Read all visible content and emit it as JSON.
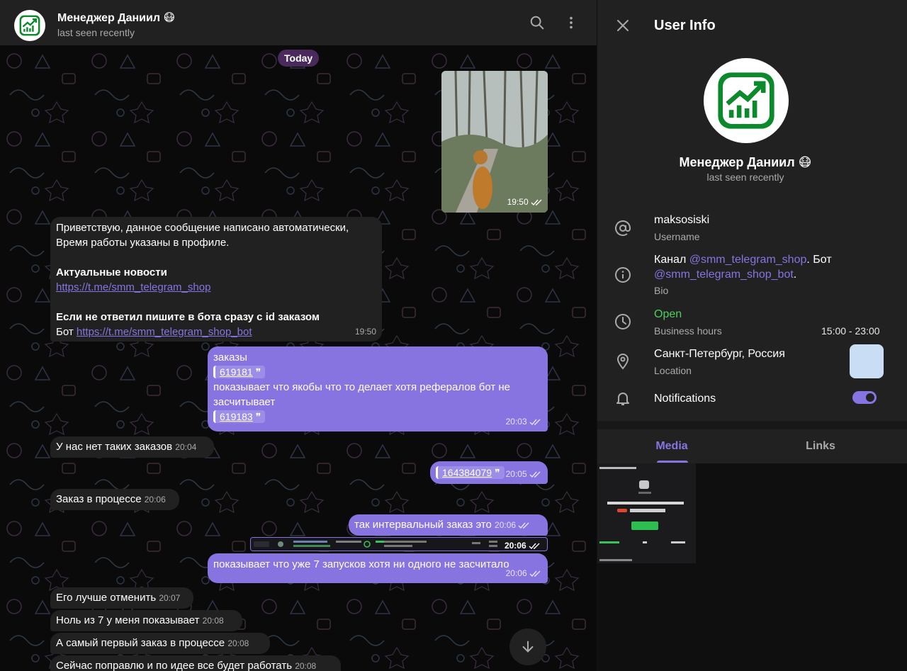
{
  "chat": {
    "header": {
      "name": "Менеджер Даниил 😷",
      "status": "last seen recently"
    },
    "date_label": "Today",
    "messages": {
      "m1_time": "19:50",
      "m2_line1": "Приветствую, данное сообщение написано автоматически,",
      "m2_line2": "Время работы указаны в профиле.",
      "m2_news_title": "Актуальные новости",
      "m2_news_link": "https://t.me/smm_telegram_shop",
      "m2_note": "Если не ответил пишите в бота сразу с id заказом",
      "m2_bot_prefix": "Бот ",
      "m2_bot_link": "https://t.me/smm_telegram_shop_bot",
      "m2_time": "19:50",
      "m3_line1": "заказы",
      "m3_quote1": "619181",
      "m3_line2": "показывает что якобы что то делает хотя рефералов бот не",
      "m3_line3": "засчитывает",
      "m3_quote2": "619183",
      "m3_time": "20:03",
      "m4_text": "У нас нет таких заказов",
      "m4_time": "20:04",
      "m5_quote": "164384079",
      "m5_time": "20:05",
      "m6_text": "Заказ в процессе",
      "m6_time": "20:06",
      "m7_text": "так интервальный заказ это",
      "m7_time": "20:06",
      "m8_time": "20:06",
      "m9_text": "показывает что уже 7 запусков хотя ни одного не засчитало",
      "m9_time": "20:06",
      "m10_text": "Его лучше отменить",
      "m10_time": "20:07",
      "m11_text": "Ноль из 7 у меня показывает",
      "m11_time": "20:08",
      "m12_text": "А самый первый заказ в процессе",
      "m12_time": "20:08",
      "m13_text": "Сейчас поправлю и по идее все будет работать",
      "m13_time": "20:08"
    }
  },
  "panel": {
    "title": "User Info",
    "name": "Менеджер Даниил 😷",
    "status": "last seen recently",
    "username": "maksosiski",
    "username_label": "Username",
    "bio_prefix": "Канал ",
    "bio_channel": "@smm_telegram_shop",
    "bio_mid": ". Бот",
    "bio_bot": "@smm_telegram_shop_bot",
    "bio_suffix": ".",
    "bio_label": "Bio",
    "hours_state": "Open",
    "hours_label": "Business hours",
    "hours_value": "15:00 - 23:00",
    "location": "Санкт-Петербург, Россия",
    "location_label": "Location",
    "notifications_label": "Notifications",
    "tabs": [
      "Media",
      "Links"
    ]
  },
  "colors": {
    "accent": "#8774e1",
    "incoming_bubble": "#212121",
    "panel_bg": "#212121",
    "open_green": "#4fce5d"
  }
}
